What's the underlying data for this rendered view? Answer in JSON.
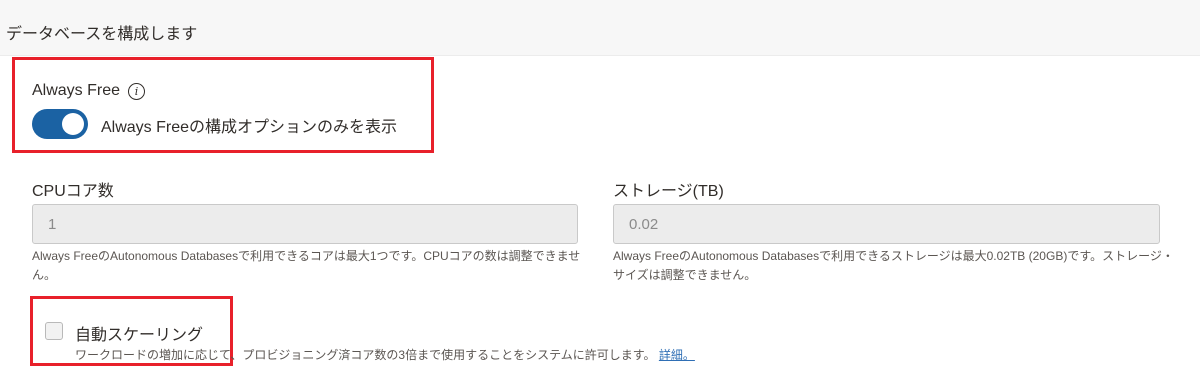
{
  "section_title": "データベースを構成します",
  "always_free": {
    "label": "Always Free",
    "info_glyph": "i",
    "toggle_text": "Always Freeの構成オプションのみを表示",
    "toggle_on": true
  },
  "cpu": {
    "label": "CPUコア数",
    "value": "1",
    "help": "Always FreeのAutonomous Databasesで利用できるコアは最大1つです。CPUコアの数は調整できません。"
  },
  "storage": {
    "label": "ストレージ(TB)",
    "value": "0.02",
    "help": "Always FreeのAutonomous Databasesで利用できるストレージは最大0.02TB (20GB)です。ストレージ・サイズは調整できません。"
  },
  "auto_scaling": {
    "label": "自動スケーリング",
    "checked": false,
    "help": "ワークロードの増加に応じて、プロビジョニング済コア数の3倍まで使用することをシステムに許可します。",
    "link_text": "詳細。"
  },
  "colors": {
    "toggle_on": "#1b62a3",
    "highlight": "#e8202a",
    "link": "#2f6fb5"
  }
}
